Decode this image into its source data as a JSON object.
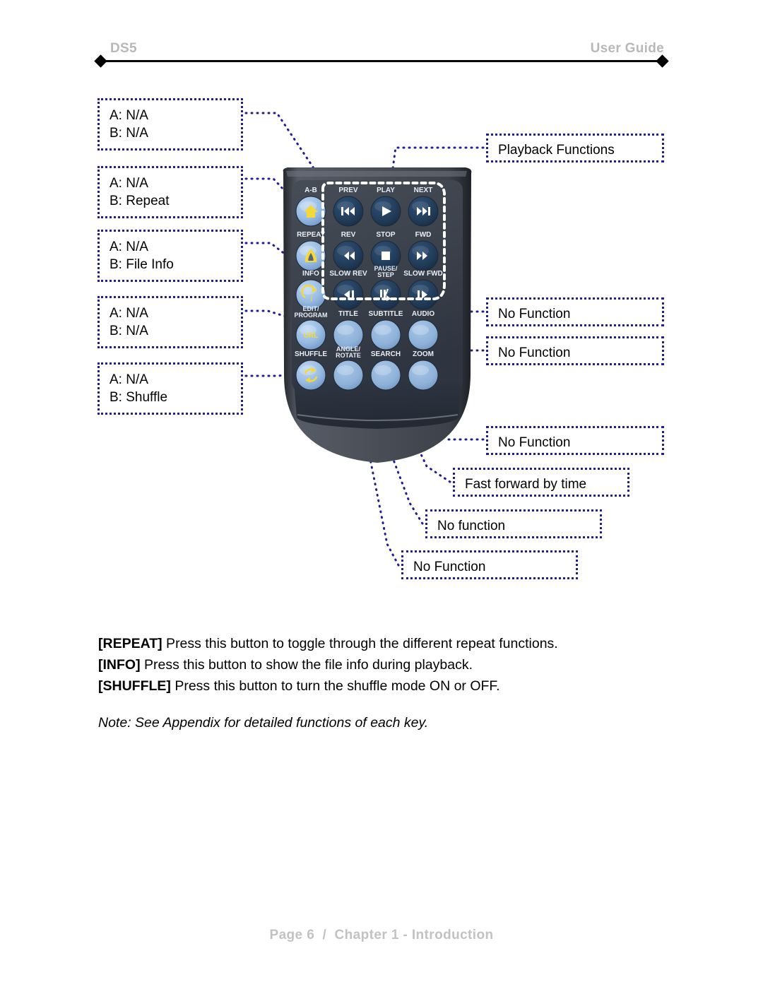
{
  "header": {
    "left_label": "DS5",
    "right_label": "User Guide",
    "rule_color": "#000000",
    "text_color": "#b8b8b8"
  },
  "callouts": {
    "border_color": "#1f1f8f",
    "left": [
      {
        "line_a": "A: N/A",
        "line_b": "B: N/A"
      },
      {
        "line_a": "A: N/A",
        "line_b": "B: Repeat"
      },
      {
        "line_a": "A: N/A",
        "line_b": "B: File Info"
      },
      {
        "line_a": "A: N/A",
        "line_b": "B: N/A"
      },
      {
        "line_a": "A: N/A",
        "line_b": "B: Shuffle"
      }
    ],
    "right": [
      {
        "text": "Playback Functions"
      },
      {
        "text": "No Function"
      },
      {
        "text": "No Function"
      },
      {
        "text": "No Function"
      },
      {
        "text": "Fast forward by time"
      },
      {
        "text": "No function"
      },
      {
        "text": "No Function"
      }
    ]
  },
  "remote": {
    "body_color": "#4a4f57",
    "keypad_color": "#3b434e",
    "button_color": "#9dc0e6",
    "label_color": "#e8eef6",
    "icon_color": "#f2d83a",
    "highlight_outline_color": "#ffffff",
    "rows": [
      {
        "keys": [
          {
            "label": "A-B",
            "glyph": "home",
            "style": "icon"
          },
          {
            "label": "PREV",
            "glyph": "prev",
            "style": "media"
          },
          {
            "label": "PLAY",
            "glyph": "play",
            "style": "media"
          },
          {
            "label": "NEXT",
            "glyph": "next",
            "style": "media"
          }
        ]
      },
      {
        "keys": [
          {
            "label": "REPEAT",
            "glyph": "repeat",
            "style": "icon"
          },
          {
            "label": "REV",
            "glyph": "rev",
            "style": "media"
          },
          {
            "label": "STOP",
            "glyph": "stop",
            "style": "media"
          },
          {
            "label": "FWD",
            "glyph": "fwd",
            "style": "media"
          }
        ]
      },
      {
        "keys": [
          {
            "label": "INFO",
            "glyph": "info",
            "style": "icon"
          },
          {
            "label": "SLOW REV",
            "glyph": "slowrev",
            "style": "media"
          },
          {
            "label": "PAUSE/\nSTEP",
            "glyph": "pausestep",
            "style": "media"
          },
          {
            "label": "SLOW FWD",
            "glyph": "slowfwd",
            "style": "media"
          }
        ]
      },
      {
        "keys": [
          {
            "label": "EDIT/\nPROGRAM",
            "glyph": "url",
            "style": "text"
          },
          {
            "label": "TITLE",
            "glyph": "",
            "style": "plain"
          },
          {
            "label": "SUBTITLE",
            "glyph": "",
            "style": "plain"
          },
          {
            "label": "AUDIO",
            "glyph": "",
            "style": "plain"
          }
        ]
      },
      {
        "keys": [
          {
            "label": "SHUFFLE",
            "glyph": "shuffle",
            "style": "icon"
          },
          {
            "label": "ANGLE/\nROTATE",
            "glyph": "",
            "style": "plain"
          },
          {
            "label": "SEARCH",
            "glyph": "",
            "style": "plain"
          },
          {
            "label": "ZOOM",
            "glyph": "",
            "style": "plain"
          }
        ]
      }
    ],
    "url_key_text": "URL"
  },
  "body": {
    "lines": [
      {
        "bold": "[REPEAT]",
        "rest": " Press this button to toggle through the different repeat functions."
      },
      {
        "bold": "[INFO]",
        "rest": " Press this button to show the file info during playback."
      },
      {
        "bold": "[SHUFFLE]",
        "rest": " Press this button to turn the shuffle mode ON or OFF."
      }
    ],
    "note": "Note: See Appendix for detailed functions of each key."
  },
  "footer": {
    "text": "Page 6  /  Chapter 1 - Introduction"
  }
}
